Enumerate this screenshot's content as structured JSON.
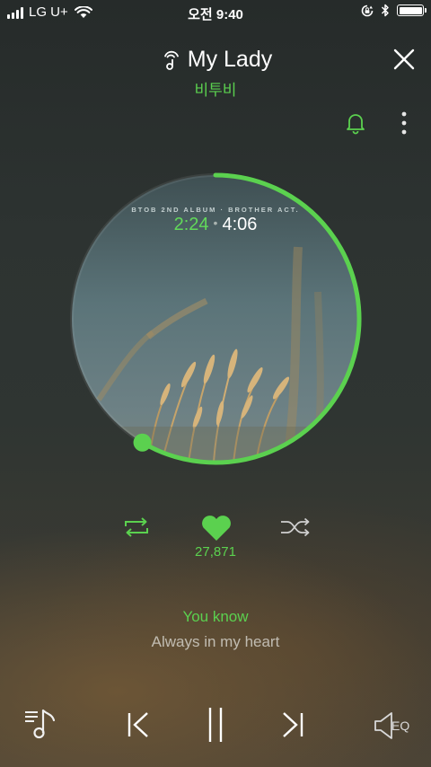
{
  "status_bar": {
    "carrier": "LG U+",
    "time": "오전 9:40",
    "signal_bars": 4,
    "icons": [
      "wifi-icon",
      "orientation-lock-icon",
      "bluetooth-icon",
      "battery-icon"
    ],
    "battery_level": 1.0
  },
  "header": {
    "song_title": "My Lady",
    "artist": "비투비",
    "icons": [
      "music-note-icon",
      "close-icon",
      "bell-icon",
      "more-vertical-icon"
    ]
  },
  "player": {
    "album_caption": "BTOB 2ND ALBUM · BROTHER ACT.",
    "elapsed": "2:24",
    "separator": "•",
    "total": "4:06",
    "progress": 0.585
  },
  "actions": {
    "like_count": "27,871",
    "icons": [
      "repeat-icon",
      "heart-icon",
      "shuffle-icon"
    ]
  },
  "lyrics": {
    "current": "You know",
    "next": "Always in my heart"
  },
  "controls": {
    "eq_label": "EQ",
    "icons": [
      "playlist-icon",
      "previous-icon",
      "pause-icon",
      "next-icon",
      "equalizer-icon"
    ]
  },
  "colors": {
    "accent": "#5bd14f",
    "progress_ring": "#5bd14f",
    "text_primary": "#ffffff"
  }
}
